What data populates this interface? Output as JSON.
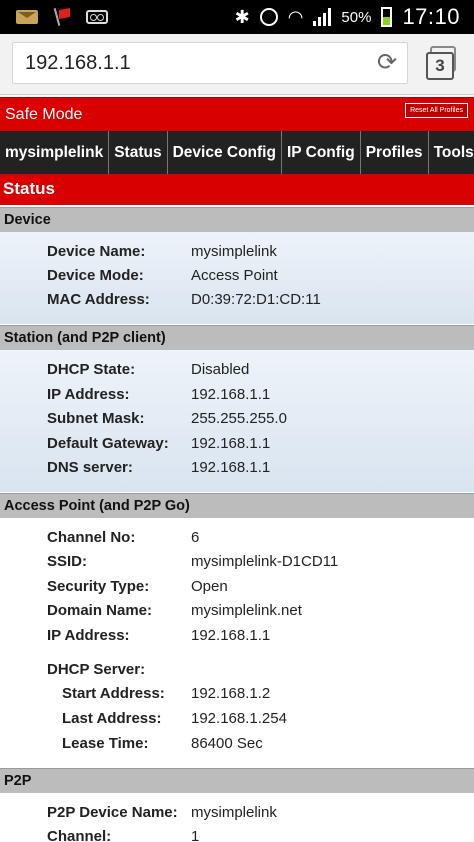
{
  "statusbar": {
    "battery_pct": "50%",
    "time": "17:10"
  },
  "browser": {
    "url": "192.168.1.1",
    "tab_count": "3"
  },
  "banner": {
    "label": "Safe Mode",
    "reset_button": "Reset All Profiles"
  },
  "nav": [
    "mysimplelink",
    "Status",
    "Device Config",
    "IP Config",
    "Profiles",
    "Tools"
  ],
  "page_title": "Status",
  "sections": {
    "device": {
      "title": "Device",
      "rows": [
        {
          "k": "Device Name:",
          "v": "mysimplelink"
        },
        {
          "k": "Device Mode:",
          "v": "Access Point"
        },
        {
          "k": "MAC Address:",
          "v": "D0:39:72:D1:CD:11"
        }
      ]
    },
    "station": {
      "title": "Station (and P2P client)",
      "rows": [
        {
          "k": "DHCP State:",
          "v": "Disabled"
        },
        {
          "k": "IP Address:",
          "v": "192.168.1.1"
        },
        {
          "k": "Subnet Mask:",
          "v": "255.255.255.0"
        },
        {
          "k": "Default Gateway:",
          "v": "192.168.1.1"
        },
        {
          "k": "DNS server:",
          "v": "192.168.1.1"
        }
      ]
    },
    "ap": {
      "title": "Access Point (and P2P Go)",
      "rows": [
        {
          "k": "Channel No:",
          "v": "6"
        },
        {
          "k": "SSID:",
          "v": "mysimplelink-D1CD11"
        },
        {
          "k": "Security Type:",
          "v": "Open"
        },
        {
          "k": "Domain Name:",
          "v": "mysimplelink.net"
        },
        {
          "k": "IP Address:",
          "v": "192.168.1.1"
        }
      ],
      "dhcp_label": "DHCP Server:",
      "dhcp_rows": [
        {
          "k": "Start Address:",
          "v": "192.168.1.2"
        },
        {
          "k": "Last Address:",
          "v": "192.168.1.254"
        },
        {
          "k": "Lease Time:",
          "v": "86400 Sec"
        }
      ]
    },
    "p2p": {
      "title": "P2P",
      "rows": [
        {
          "k": "P2P Device Name:",
          "v": "mysimplelink"
        },
        {
          "k": "Channel:",
          "v": "1"
        }
      ]
    }
  },
  "colors": {
    "accent_red": "#d80000",
    "nav_bg": "#222222",
    "section_header": "#bcbcbc"
  },
  "icons": [
    "email-icon",
    "flag-icon",
    "voicemail-icon",
    "bluetooth-icon",
    "alarm-icon",
    "wifi-icon",
    "signal-icon",
    "battery-icon",
    "reload-icon",
    "tabs-icon"
  ]
}
